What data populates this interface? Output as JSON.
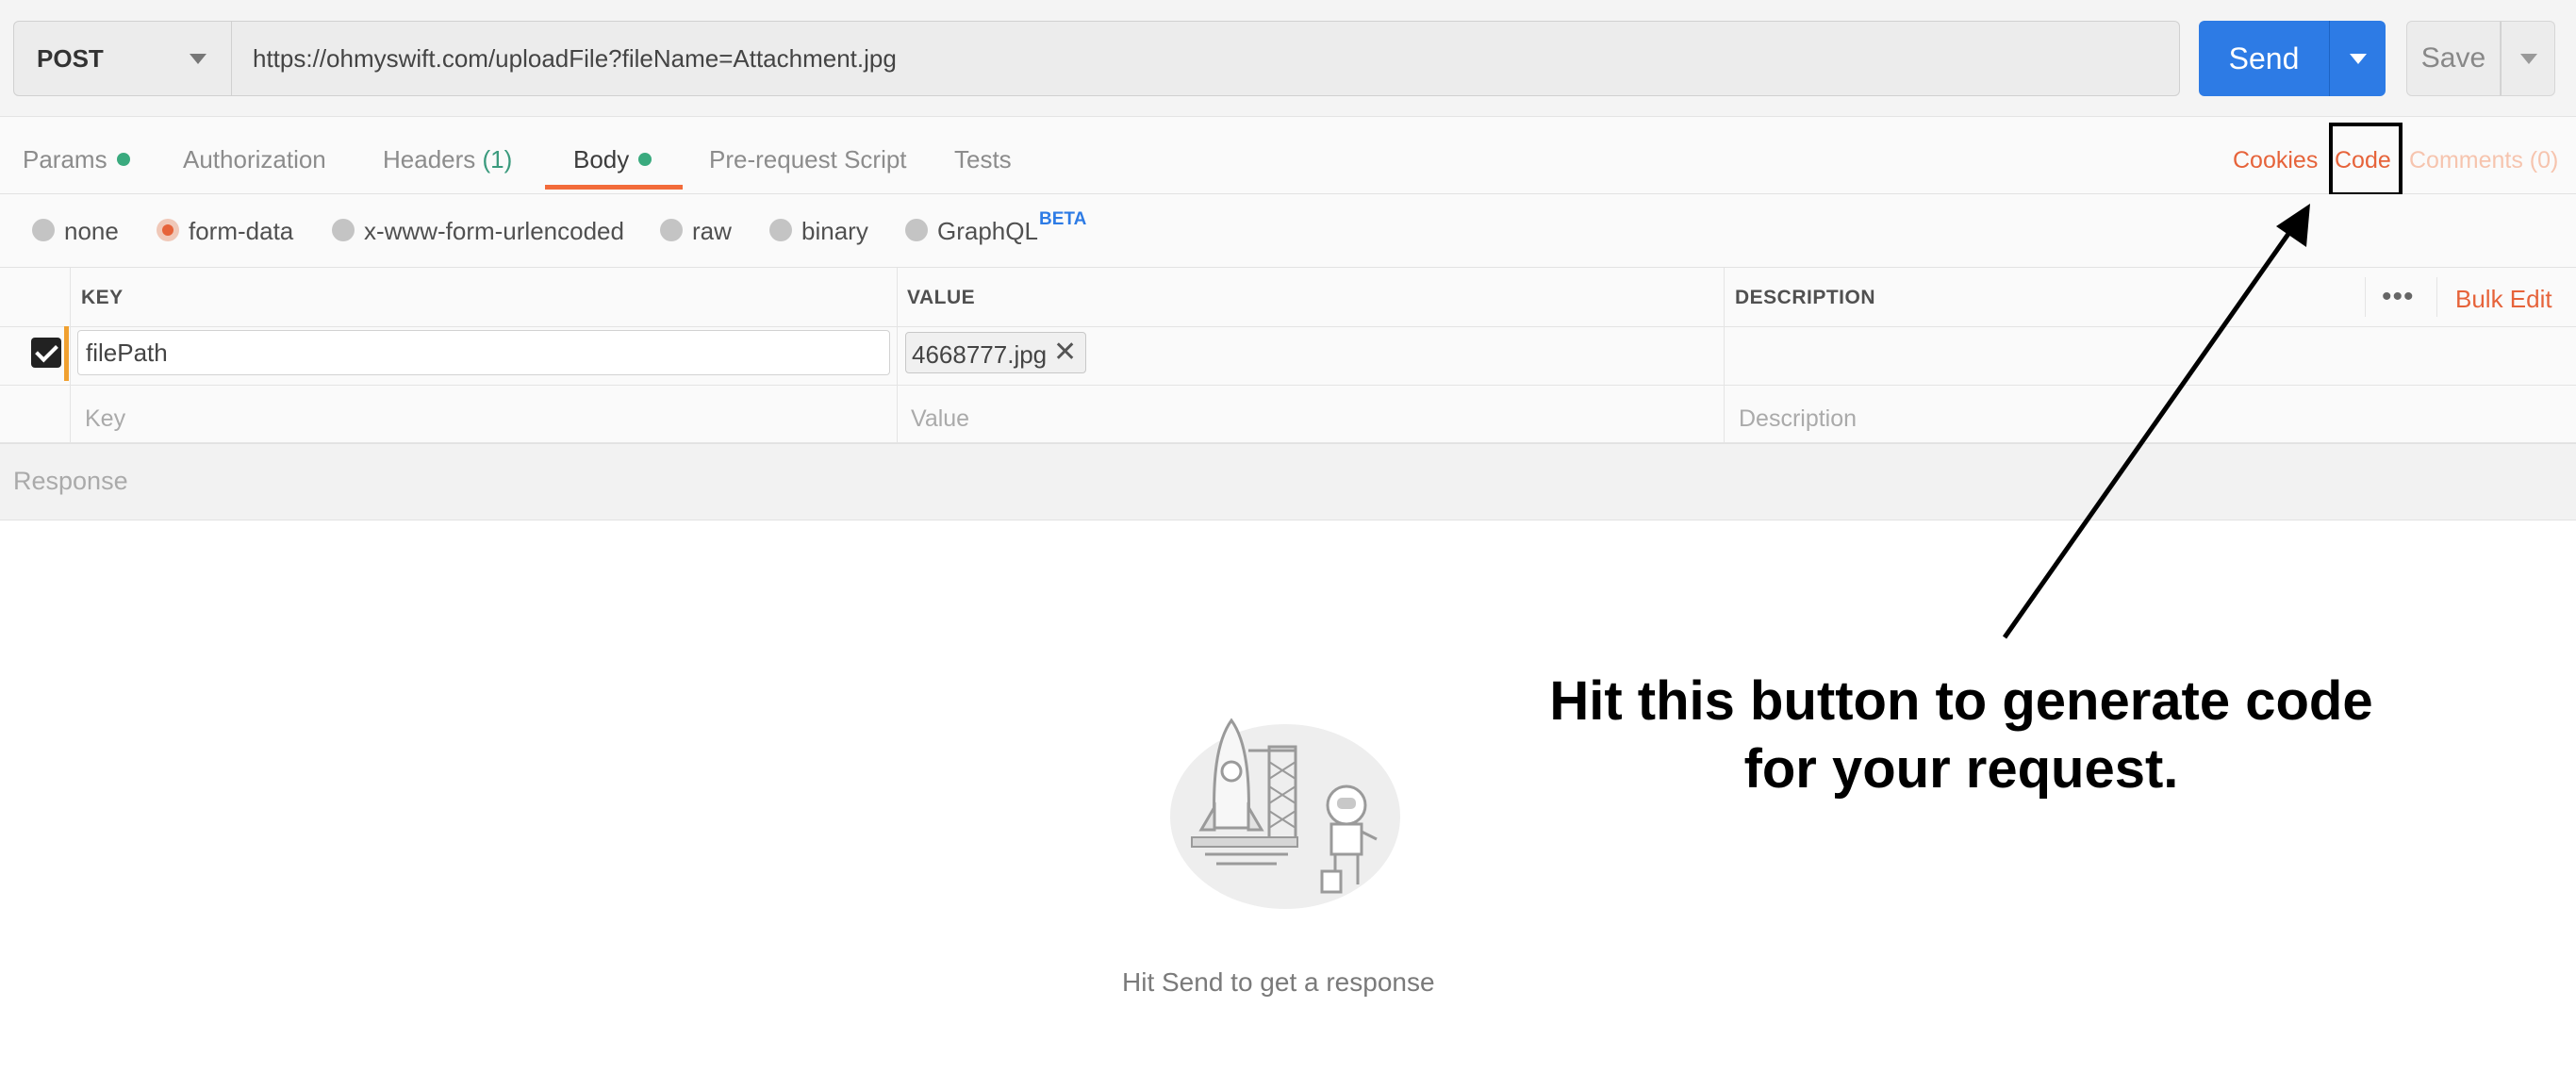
{
  "request": {
    "method": "POST",
    "url": "https://ohmyswift.com/uploadFile?fileName=Attachment.jpg",
    "send_label": "Send",
    "save_label": "Save"
  },
  "tabs": [
    {
      "label": "Params",
      "has_dot": true
    },
    {
      "label": "Authorization"
    },
    {
      "label": "Headers",
      "count": "(1)"
    },
    {
      "label": "Body",
      "has_dot": true,
      "active": true
    },
    {
      "label": "Pre-request Script"
    },
    {
      "label": "Tests"
    }
  ],
  "right_links": {
    "cookies": "Cookies",
    "code": "Code",
    "comments": "Comments (0)"
  },
  "body_types": [
    {
      "label": "none",
      "selected": false
    },
    {
      "label": "form-data",
      "selected": true
    },
    {
      "label": "x-www-form-urlencoded",
      "selected": false
    },
    {
      "label": "raw",
      "selected": false
    },
    {
      "label": "binary",
      "selected": false
    },
    {
      "label": "GraphQL",
      "selected": false,
      "badge": "BETA"
    }
  ],
  "table": {
    "headers": {
      "key": "KEY",
      "value": "VALUE",
      "description": "DESCRIPTION"
    },
    "bulk_edit": "Bulk Edit",
    "more": "•••",
    "rows": [
      {
        "checked": true,
        "key": "filePath",
        "value_file": "4668777.jpg",
        "description": ""
      }
    ],
    "placeholders": {
      "key": "Key",
      "value": "Value",
      "description": "Description"
    }
  },
  "response": {
    "title": "Response",
    "empty_message": "Hit Send to get a response"
  },
  "annotation": {
    "line1": "Hit this button to generate code",
    "line2": "for your request."
  },
  "colors": {
    "accent": "#e6633a",
    "send_blue": "#2d7be5",
    "dot_green": "#3aaa7e"
  }
}
